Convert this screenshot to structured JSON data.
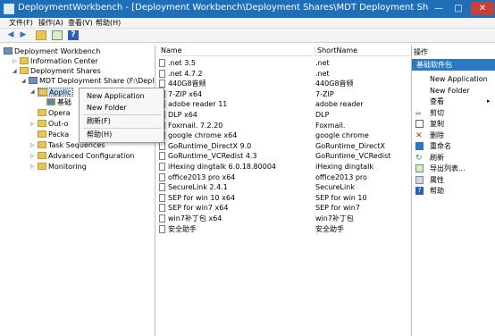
{
  "window": {
    "title": "DeploymentWorkbench - [Deployment Workbench\\Deployment Shares\\MDT Deployment Share (F:\\Deploymen...",
    "controls": [
      "—",
      "□",
      "✕"
    ]
  },
  "menubar": [
    "文件(F)",
    "操作(A)",
    "查看(V)",
    "帮助(H)"
  ],
  "toolbar": [
    "back-icon",
    "forward-icon",
    "up-folder-icon",
    "export-list-icon",
    "help-icon"
  ],
  "tree": {
    "root": "Deployment Workbench",
    "info_center": "Information Center",
    "deployment_shares": "Deployment Shares",
    "share": "MDT Deployment Share (F:\\Deployme",
    "applications": "Applic",
    "sub_app": "基础",
    "operating": "Opera",
    "outofbox": "Out-o",
    "packages": "Packa",
    "task_sequences": "Task Sequences",
    "advanced": "Advanced Configuration",
    "monitoring": "Monitoring"
  },
  "context_menu": {
    "new_application": "New Application",
    "new_folder": "New Folder",
    "refresh": "刷新(F)",
    "help": "帮助(H)"
  },
  "list": {
    "columns": [
      "Name",
      "ShortName"
    ],
    "rows": [
      [
        ".net 3.5",
        ".net"
      ],
      [
        ".net 4.7.2",
        ".net"
      ],
      [
        "440G8音频",
        "440G8音频"
      ],
      [
        "7-ZIP x64",
        "7-ZIP"
      ],
      [
        "adobe reader 11",
        "adobe reader"
      ],
      [
        "DLP x64",
        "DLP"
      ],
      [
        "Foxmail. 7.2.20",
        "Foxmail."
      ],
      [
        "google chrome x64",
        "google chrome"
      ],
      [
        "GoRuntime_DirectX 9.0",
        "GoRuntime_DirectX"
      ],
      [
        "GoRuntime_VCRedist 4.3",
        "GoRuntime_VCRedist"
      ],
      [
        "iHexing dingtalk 6.0.18.80004",
        "iHexing dingtalk"
      ],
      [
        "office2013 pro x64",
        "office2013 pro"
      ],
      [
        "SecureLink 2.4.1",
        "SecureLink"
      ],
      [
        "SEP for win 10 x64",
        "SEP for win 10"
      ],
      [
        "SEP for win7 x64",
        "SEP for win7"
      ],
      [
        "win7补丁包 x64",
        "win7补丁包"
      ],
      [
        "安全助手",
        "安全助手"
      ]
    ]
  },
  "actions": {
    "header": "操作",
    "group": "基础软件包",
    "items": [
      {
        "label": "New Application",
        "icon": ""
      },
      {
        "label": "New Folder",
        "icon": ""
      },
      {
        "label": "查看",
        "icon": ""
      },
      {
        "label": "剪切",
        "icon": "cut-icon"
      },
      {
        "label": "复制",
        "icon": "copy-icon"
      },
      {
        "label": "删除",
        "icon": "delete-icon"
      },
      {
        "label": "重命名",
        "icon": "rename-icon"
      },
      {
        "label": "刷新",
        "icon": "refresh-icon"
      },
      {
        "label": "导出列表...",
        "icon": "export-icon"
      },
      {
        "label": "属性",
        "icon": "properties-icon"
      },
      {
        "label": "帮助",
        "icon": "help-icon"
      }
    ]
  },
  "colors": {
    "title_bar": "#1f6fb8",
    "group_header": "#2b79c4",
    "close": "#c7403a"
  }
}
